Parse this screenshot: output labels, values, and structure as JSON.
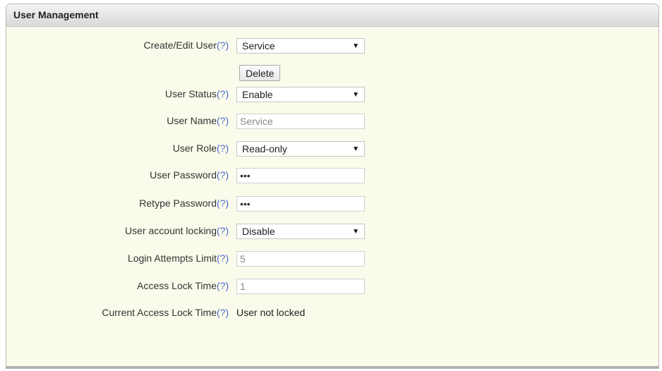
{
  "panel": {
    "title": "User Management"
  },
  "help_text": "(?)",
  "form": {
    "create_edit_user": {
      "label": "Create/Edit User",
      "value": "Service"
    },
    "delete_button": "Delete",
    "user_status": {
      "label": "User Status",
      "value": "Enable"
    },
    "user_name": {
      "label": "User Name",
      "value": "Service"
    },
    "user_role": {
      "label": "User Role",
      "value": "Read-only"
    },
    "user_password": {
      "label": "User Password",
      "value": "•••"
    },
    "retype_password": {
      "label": "Retype Password",
      "value": "•••"
    },
    "account_locking": {
      "label": "User account locking",
      "value": "Disable"
    },
    "login_attempts": {
      "label": "Login Attempts Limit",
      "value": "5"
    },
    "access_lock_time": {
      "label": "Access Lock Time",
      "value": "1"
    },
    "current_lock_time": {
      "label": "Current Access Lock Time",
      "value": "User not locked"
    }
  },
  "icons": {
    "dropdown": "dropdown-arrow-icon",
    "help": "help-icon"
  },
  "colors": {
    "panel_bg": "#fbfbeb",
    "help_link": "#4a6bd6",
    "header_bg": "#e4e4e4"
  }
}
